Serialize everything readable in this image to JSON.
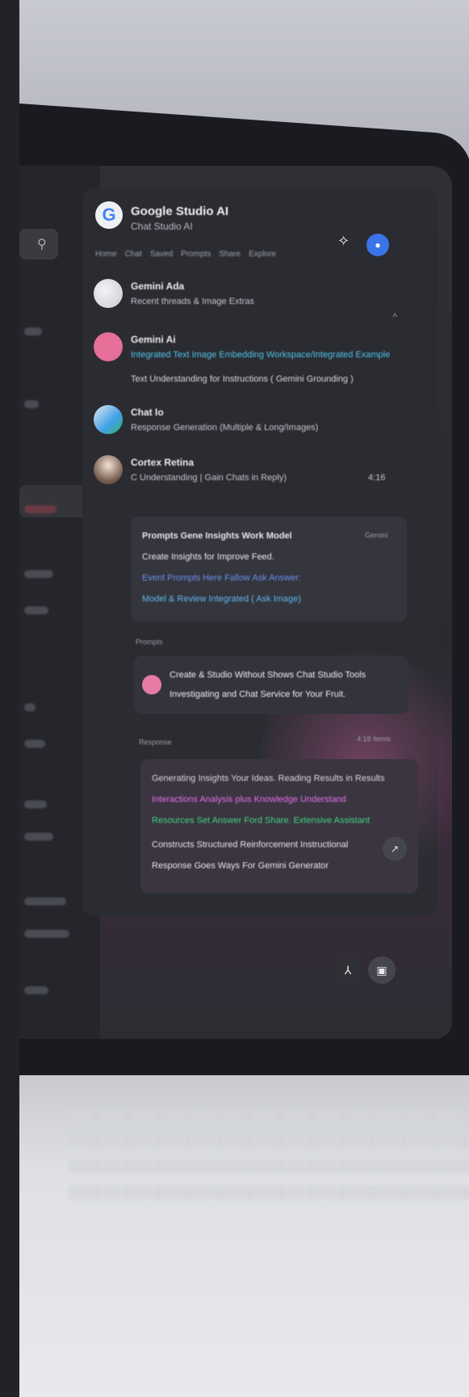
{
  "app": {
    "title": "Google Studio AI",
    "subtitle": "Chat Studio AI",
    "tabs": [
      "Home",
      "Chat",
      "Saved",
      "Prompts",
      "Share",
      "Explore"
    ]
  },
  "messages": [
    {
      "name": "Gemini Ada",
      "text": "Recent threads & Image Extras"
    },
    {
      "name": "Gemini Ai",
      "text": "Integrated Text Image Embedding Workspace/Integrated Example",
      "text2": "Text Understanding for Instructions ( Gemini Grounding )"
    },
    {
      "name": "Chat Io",
      "text": "Response Generation (Multiple & Long/Images)"
    },
    {
      "name": "Cortex Retina",
      "text": "C Understanding | Gain Chats in Reply)",
      "time": "4:16"
    }
  ],
  "card1": {
    "lines": [
      "Prompts Gene Insights Work Model",
      "Create Insights for Improve Feed.",
      "Event Prompts Here Fallow Ask Answer:",
      "Model & Review Integrated ( Ask Image)"
    ],
    "tag": "Gemini"
  },
  "label_prompts": "Prompts",
  "bubble": {
    "line1": "Create & Studio Without Shows Chat Studio Tools",
    "line2": "Investigating and Chat Service for Your Fruit."
  },
  "label_response": "Response",
  "label_time": "4:18 Items",
  "card2": {
    "lines": [
      "Generating Insights Your Ideas. Reading Results in Results",
      "Interactions Analysis plus Knowledge Understand",
      "Resources Set Answer Ford Share. Extensive Assistant",
      "Constructs Structured Reinforcement Instructional",
      "Response Goes Ways For Gemini Generator"
    ]
  },
  "colors": {
    "accent": "#3b74e8",
    "pink": "#e67ba6",
    "green": "#42d17f",
    "cyan": "#4fc3e6",
    "yellow": "#e8d26a",
    "magenta": "#e56fe6",
    "blue": "#6b8cf0"
  },
  "icons": {
    "search": "search-icon",
    "pin": "pin-icon",
    "send": "send-icon",
    "mic": "mic-icon",
    "attach": "attach-icon",
    "add": "add-icon"
  }
}
